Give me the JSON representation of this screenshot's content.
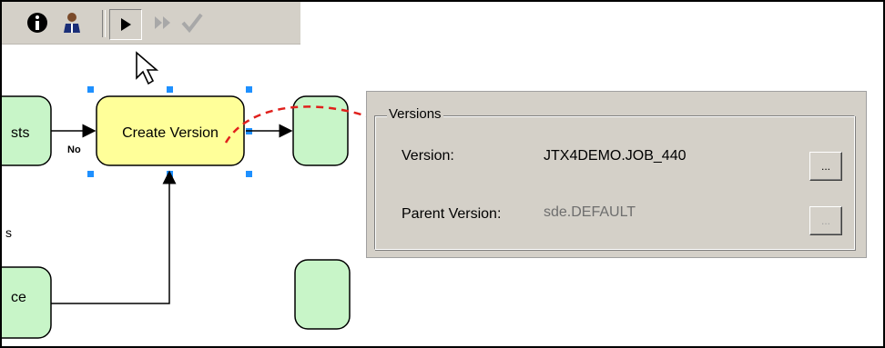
{
  "toolbar": {
    "icons": [
      "info-icon",
      "user-icon",
      "run-icon",
      "run-all-icon",
      "checkmark-icon"
    ]
  },
  "workflow": {
    "nodes": {
      "left_top": "sts",
      "create_version": "Create Version",
      "left_bottom": "ce"
    },
    "edge_label_no": "No",
    "side_fragment": "s"
  },
  "versions_panel": {
    "group_title": "Versions",
    "version_label": "Version:",
    "version_value": "JTX4DEMO.JOB_440",
    "version_button": "...",
    "parent_label": "Parent Version:",
    "parent_value": "sde.DEFAULT",
    "parent_button": "..."
  },
  "colors": {
    "node_fill_green": "#c8f5c8",
    "node_fill_yellow": "#ffff99",
    "callout_arrow": "#e0201c",
    "selection_handle": "#1e90ff"
  }
}
